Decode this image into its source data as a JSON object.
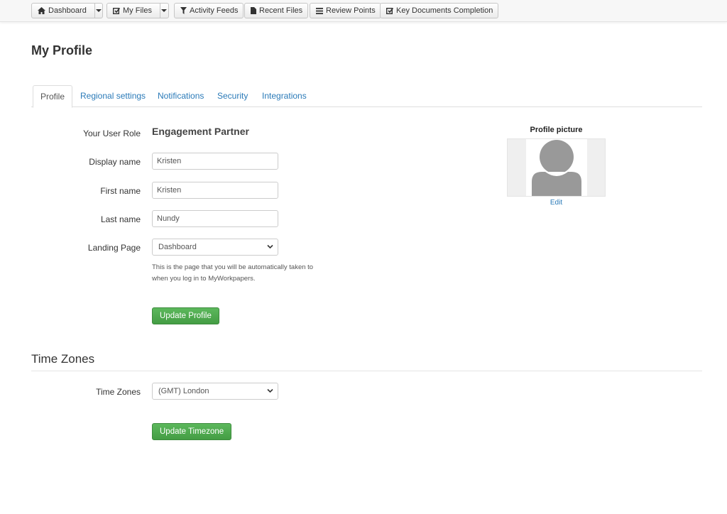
{
  "toolbar": {
    "dashboard": "Dashboard",
    "my_files": "My Files",
    "activity_feeds": "Activity Feeds",
    "recent_files": "Recent Files",
    "review_points": "Review Points",
    "key_documents_completion": "Key Documents Completion"
  },
  "page": {
    "title": "My Profile"
  },
  "tabs": [
    {
      "label": "Profile",
      "active": true
    },
    {
      "label": "Regional settings"
    },
    {
      "label": "Notifications"
    },
    {
      "label": "Security"
    },
    {
      "label": "Integrations"
    }
  ],
  "profile": {
    "role_label": "Your User Role",
    "role_value": "Engagement Partner",
    "display_name_label": "Display name",
    "display_name_value": "Kristen",
    "first_name_label": "First name",
    "first_name_value": "Kristen",
    "last_name_label": "Last name",
    "last_name_value": "Nundy",
    "landing_page_label": "Landing Page",
    "landing_page_value": "Dashboard",
    "landing_help": "This is the page that you will be automatically taken to when you log in to MyWorkpapers.",
    "update_button": "Update Profile"
  },
  "picture": {
    "title": "Profile picture",
    "edit_label": "Edit"
  },
  "timezones": {
    "section_title": "Time Zones",
    "label": "Time Zones",
    "value": "(GMT) London",
    "update_button": "Update Timezone"
  },
  "colors": {
    "link": "#2a7ab8",
    "success": "#5cb85c",
    "avatar": "#999999"
  }
}
